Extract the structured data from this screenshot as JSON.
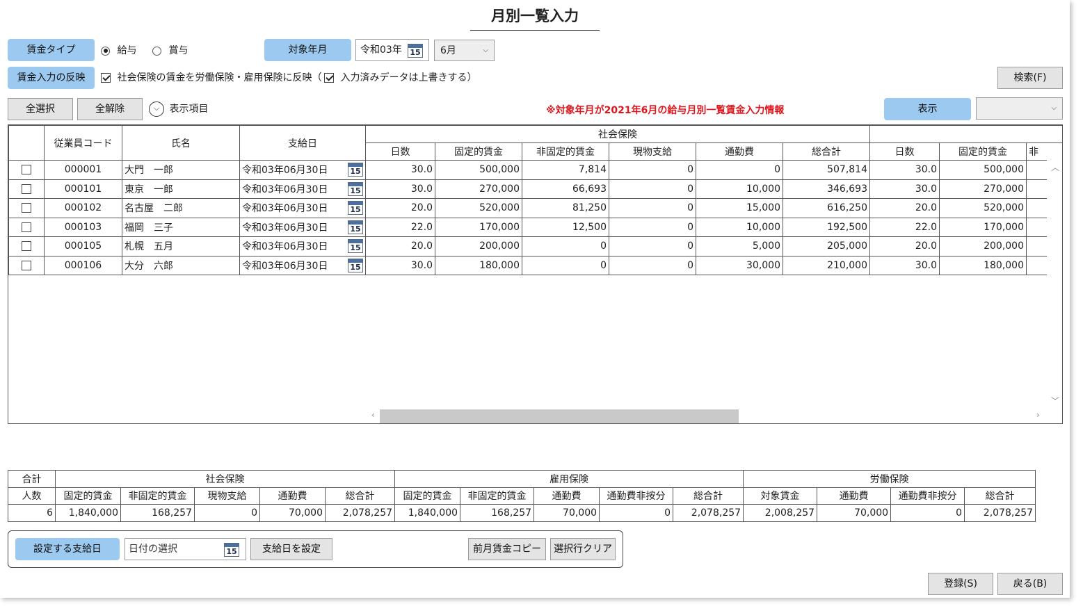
{
  "title": "月別一覧入力",
  "wage_type": {
    "label": "賃金タイプ",
    "options": [
      "給与",
      "賞与"
    ],
    "selected": "給与"
  },
  "target_month": {
    "label": "対象年月",
    "year_value": "令和03年",
    "month_value": "6月"
  },
  "reflect": {
    "label": "賃金入力の反映",
    "option1": "社会保険の賃金を労働保険・雇用保険に反映（",
    "option2": "入力済みデータは上書きする）"
  },
  "search_button": "検索(F)",
  "select_all": "全選択",
  "deselect_all": "全解除",
  "display_items": "表示項目",
  "notice": "※対象年月が2021年6月の給与月別一覧賃金入力情報",
  "display_tag": "表示",
  "display_select_value": "",
  "grid": {
    "headers": {
      "code": "従業員コード",
      "name": "氏名",
      "paydate": "支給日",
      "group1": "社会保険",
      "days": "日数",
      "fixed": "固定的賃金",
      "nonfixed": "非固定的賃金",
      "inkind": "現物支給",
      "commute": "通勤費",
      "total": "総合計",
      "days2": "日数",
      "fixed2": "固定的賃金",
      "nonfixed2_partial": "非"
    },
    "rows": [
      {
        "code": "000001",
        "name": "大門　一郎",
        "paydate": "令和03年06月30日",
        "days": "30.0",
        "fixed": "500,000",
        "nonfixed": "7,814",
        "inkind": "0",
        "commute": "0",
        "total": "507,814",
        "days2": "30.0",
        "fixed2": "500,000"
      },
      {
        "code": "000101",
        "name": "東京　一郎",
        "paydate": "令和03年06月30日",
        "days": "30.0",
        "fixed": "270,000",
        "nonfixed": "66,693",
        "inkind": "0",
        "commute": "10,000",
        "total": "346,693",
        "days2": "30.0",
        "fixed2": "270,000"
      },
      {
        "code": "000102",
        "name": "名古屋　二郎",
        "paydate": "令和03年06月30日",
        "days": "20.0",
        "fixed": "520,000",
        "nonfixed": "81,250",
        "inkind": "0",
        "commute": "15,000",
        "total": "616,250",
        "days2": "20.0",
        "fixed2": "520,000"
      },
      {
        "code": "000103",
        "name": "福岡　三子",
        "paydate": "令和03年06月30日",
        "days": "22.0",
        "fixed": "170,000",
        "nonfixed": "12,500",
        "inkind": "0",
        "commute": "10,000",
        "total": "192,500",
        "days2": "22.0",
        "fixed2": "170,000"
      },
      {
        "code": "000105",
        "name": "札幌　五月",
        "paydate": "令和03年06月30日",
        "days": "20.0",
        "fixed": "200,000",
        "nonfixed": "0",
        "inkind": "0",
        "commute": "5,000",
        "total": "205,000",
        "days2": "20.0",
        "fixed2": "200,000"
      },
      {
        "code": "000106",
        "name": "大分　六郎",
        "paydate": "令和03年06月30日",
        "days": "30.0",
        "fixed": "180,000",
        "nonfixed": "0",
        "inkind": "0",
        "commute": "30,000",
        "total": "210,000",
        "days2": "30.0",
        "fixed2": "180,000"
      }
    ],
    "calendar_day": "15"
  },
  "totals": {
    "headers": {
      "sum": "合計",
      "people": "人数",
      "social": "社会保険",
      "employment": "雇用保険",
      "labor": "労働保険",
      "fixed": "固定的賃金",
      "nonfixed": "非固定的賃金",
      "inkind": "現物支給",
      "commute": "通勤費",
      "total": "総合計",
      "commute_nonprorated": "通勤費非按分",
      "target_wage": "対象賃金"
    },
    "values": {
      "people": "6",
      "s_fixed": "1,840,000",
      "s_nonfixed": "168,257",
      "s_inkind": "0",
      "s_commute": "70,000",
      "s_total": "2,078,257",
      "e_fixed": "1,840,000",
      "e_nonfixed": "168,257",
      "e_commute": "70,000",
      "e_commute_np": "0",
      "e_total": "2,078,257",
      "l_target": "2,008,257",
      "l_commute": "70,000",
      "l_commute_np": "0",
      "l_total": "2,078,257"
    }
  },
  "paydate_panel": {
    "label": "設定する支給日",
    "placeholder": "日付の選択",
    "set_button": "支給日を設定",
    "copy_button": "前月賃金コピー",
    "clear_button": "選択行クリア"
  },
  "register_button": "登録(S)",
  "back_button": "戻る(B)"
}
